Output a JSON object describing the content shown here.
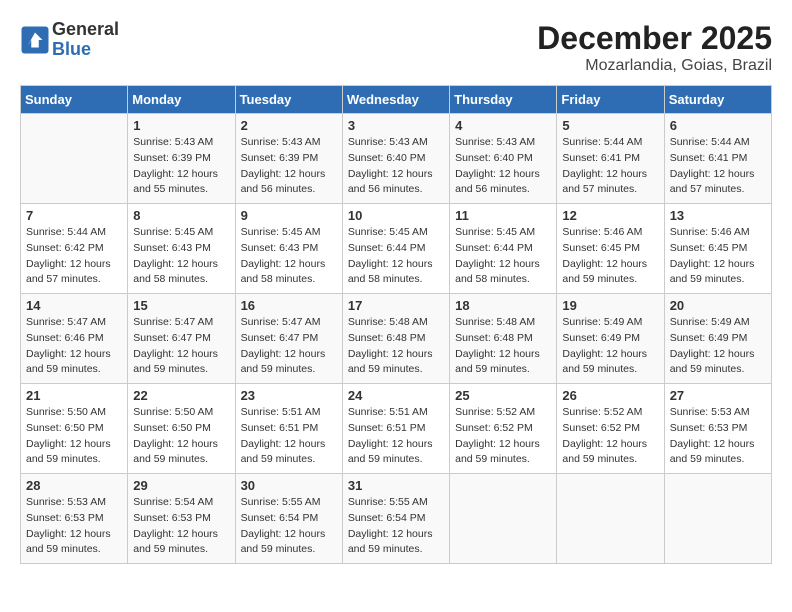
{
  "header": {
    "logo_line1": "General",
    "logo_line2": "Blue",
    "title": "December 2025",
    "subtitle": "Mozarlandia, Goias, Brazil"
  },
  "calendar": {
    "columns": [
      "Sunday",
      "Monday",
      "Tuesday",
      "Wednesday",
      "Thursday",
      "Friday",
      "Saturday"
    ],
    "rows": [
      [
        {
          "day": "",
          "info": ""
        },
        {
          "day": "1",
          "info": "Sunrise: 5:43 AM\nSunset: 6:39 PM\nDaylight: 12 hours\nand 55 minutes."
        },
        {
          "day": "2",
          "info": "Sunrise: 5:43 AM\nSunset: 6:39 PM\nDaylight: 12 hours\nand 56 minutes."
        },
        {
          "day": "3",
          "info": "Sunrise: 5:43 AM\nSunset: 6:40 PM\nDaylight: 12 hours\nand 56 minutes."
        },
        {
          "day": "4",
          "info": "Sunrise: 5:43 AM\nSunset: 6:40 PM\nDaylight: 12 hours\nand 56 minutes."
        },
        {
          "day": "5",
          "info": "Sunrise: 5:44 AM\nSunset: 6:41 PM\nDaylight: 12 hours\nand 57 minutes."
        },
        {
          "day": "6",
          "info": "Sunrise: 5:44 AM\nSunset: 6:41 PM\nDaylight: 12 hours\nand 57 minutes."
        }
      ],
      [
        {
          "day": "7",
          "info": "Sunrise: 5:44 AM\nSunset: 6:42 PM\nDaylight: 12 hours\nand 57 minutes."
        },
        {
          "day": "8",
          "info": "Sunrise: 5:45 AM\nSunset: 6:43 PM\nDaylight: 12 hours\nand 58 minutes."
        },
        {
          "day": "9",
          "info": "Sunrise: 5:45 AM\nSunset: 6:43 PM\nDaylight: 12 hours\nand 58 minutes."
        },
        {
          "day": "10",
          "info": "Sunrise: 5:45 AM\nSunset: 6:44 PM\nDaylight: 12 hours\nand 58 minutes."
        },
        {
          "day": "11",
          "info": "Sunrise: 5:45 AM\nSunset: 6:44 PM\nDaylight: 12 hours\nand 58 minutes."
        },
        {
          "day": "12",
          "info": "Sunrise: 5:46 AM\nSunset: 6:45 PM\nDaylight: 12 hours\nand 59 minutes."
        },
        {
          "day": "13",
          "info": "Sunrise: 5:46 AM\nSunset: 6:45 PM\nDaylight: 12 hours\nand 59 minutes."
        }
      ],
      [
        {
          "day": "14",
          "info": "Sunrise: 5:47 AM\nSunset: 6:46 PM\nDaylight: 12 hours\nand 59 minutes."
        },
        {
          "day": "15",
          "info": "Sunrise: 5:47 AM\nSunset: 6:47 PM\nDaylight: 12 hours\nand 59 minutes."
        },
        {
          "day": "16",
          "info": "Sunrise: 5:47 AM\nSunset: 6:47 PM\nDaylight: 12 hours\nand 59 minutes."
        },
        {
          "day": "17",
          "info": "Sunrise: 5:48 AM\nSunset: 6:48 PM\nDaylight: 12 hours\nand 59 minutes."
        },
        {
          "day": "18",
          "info": "Sunrise: 5:48 AM\nSunset: 6:48 PM\nDaylight: 12 hours\nand 59 minutes."
        },
        {
          "day": "19",
          "info": "Sunrise: 5:49 AM\nSunset: 6:49 PM\nDaylight: 12 hours\nand 59 minutes."
        },
        {
          "day": "20",
          "info": "Sunrise: 5:49 AM\nSunset: 6:49 PM\nDaylight: 12 hours\nand 59 minutes."
        }
      ],
      [
        {
          "day": "21",
          "info": "Sunrise: 5:50 AM\nSunset: 6:50 PM\nDaylight: 12 hours\nand 59 minutes."
        },
        {
          "day": "22",
          "info": "Sunrise: 5:50 AM\nSunset: 6:50 PM\nDaylight: 12 hours\nand 59 minutes."
        },
        {
          "day": "23",
          "info": "Sunrise: 5:51 AM\nSunset: 6:51 PM\nDaylight: 12 hours\nand 59 minutes."
        },
        {
          "day": "24",
          "info": "Sunrise: 5:51 AM\nSunset: 6:51 PM\nDaylight: 12 hours\nand 59 minutes."
        },
        {
          "day": "25",
          "info": "Sunrise: 5:52 AM\nSunset: 6:52 PM\nDaylight: 12 hours\nand 59 minutes."
        },
        {
          "day": "26",
          "info": "Sunrise: 5:52 AM\nSunset: 6:52 PM\nDaylight: 12 hours\nand 59 minutes."
        },
        {
          "day": "27",
          "info": "Sunrise: 5:53 AM\nSunset: 6:53 PM\nDaylight: 12 hours\nand 59 minutes."
        }
      ],
      [
        {
          "day": "28",
          "info": "Sunrise: 5:53 AM\nSunset: 6:53 PM\nDaylight: 12 hours\nand 59 minutes."
        },
        {
          "day": "29",
          "info": "Sunrise: 5:54 AM\nSunset: 6:53 PM\nDaylight: 12 hours\nand 59 minutes."
        },
        {
          "day": "30",
          "info": "Sunrise: 5:55 AM\nSunset: 6:54 PM\nDaylight: 12 hours\nand 59 minutes."
        },
        {
          "day": "31",
          "info": "Sunrise: 5:55 AM\nSunset: 6:54 PM\nDaylight: 12 hours\nand 59 minutes."
        },
        {
          "day": "",
          "info": ""
        },
        {
          "day": "",
          "info": ""
        },
        {
          "day": "",
          "info": ""
        }
      ]
    ]
  }
}
